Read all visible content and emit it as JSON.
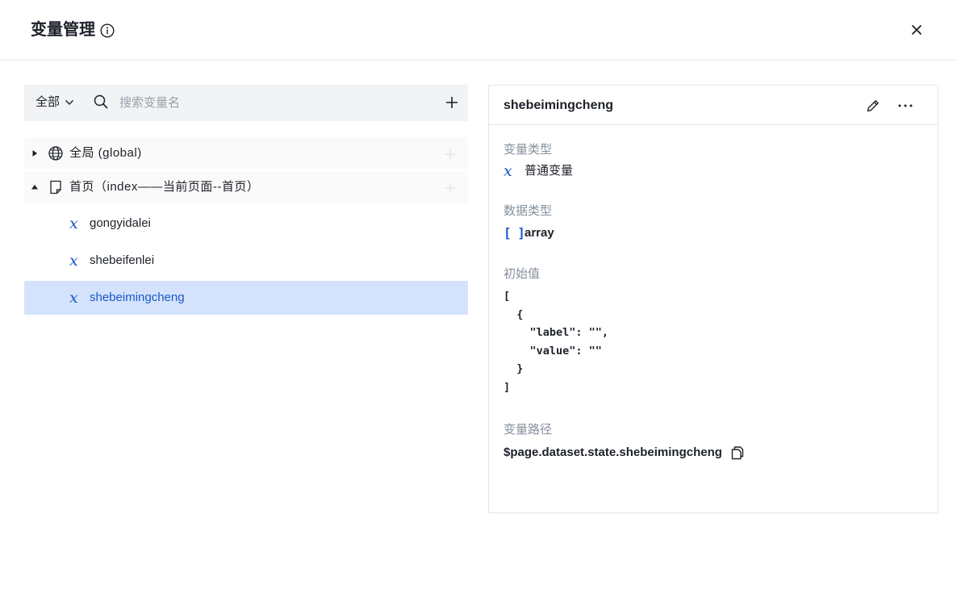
{
  "header": {
    "title": "变量管理",
    "info_icon": "info-icon",
    "close_icon": "close-icon"
  },
  "toolbar": {
    "scope_label": "全部",
    "search_placeholder": "搜索变量名",
    "search_value": "",
    "add_icon": "plus-icon"
  },
  "tree": {
    "groups": [
      {
        "label": "全局 (global)",
        "expanded": false,
        "icon": "globe-icon"
      },
      {
        "label": "首页（index——当前页面--首页）",
        "expanded": true,
        "icon": "page-icon"
      }
    ],
    "variables": [
      {
        "label": "gongyidalei",
        "selected": false
      },
      {
        "label": "shebeifenlei",
        "selected": false
      },
      {
        "label": "shebeimingcheng",
        "selected": true
      }
    ]
  },
  "detail": {
    "title": "shebeimingcheng",
    "var_type_label": "变量类型",
    "var_type_value": "普通变量",
    "data_type_label": "数据类型",
    "data_type_icon": "[ ]",
    "data_type_value": "array",
    "initial_label": "初始值",
    "initial_value": "[\n  {\n    \"label\": \"\",\n    \"value\": \"\"\n  }\n]",
    "path_label": "变量路径",
    "path_value": "$page.dataset.state.shebeimingcheng"
  },
  "colors": {
    "accent": "#1b57c9",
    "selected_bg": "#d4e3fb",
    "toolbar_bg": "#f2f3f5",
    "muted_text": "#86909c",
    "border": "#e5e6eb"
  }
}
